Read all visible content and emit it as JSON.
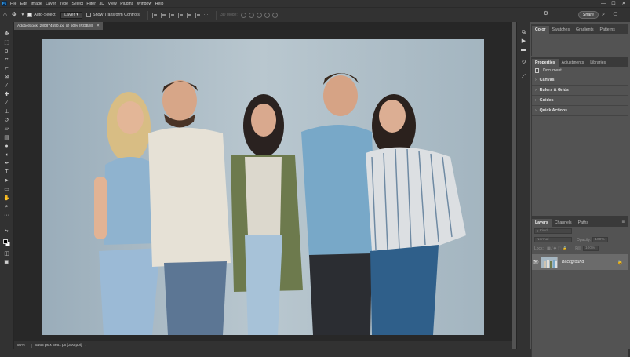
{
  "app": {
    "logo_text": "Ps",
    "menu": [
      "File",
      "Edit",
      "Image",
      "Layer",
      "Type",
      "Select",
      "Filter",
      "3D",
      "View",
      "Plugins",
      "Window",
      "Help"
    ],
    "window_controls": {
      "minimize": "—",
      "maximize": "☐",
      "close": "✕"
    }
  },
  "options_bar": {
    "auto_select_label": "Auto-Select:",
    "auto_select_checked": true,
    "auto_select_target": "Layer",
    "show_transform_label": "Show Transform Controls",
    "show_transform_checked": false,
    "mode_3d_label": "3D Mode:",
    "share_label": "Share"
  },
  "document": {
    "tab_title": "AdobeStock_280874550.jpg @ 50% (RGB/8)",
    "tab_close": "×",
    "zoom": "50%",
    "dimensions": "5463 px x 3661 px (300 ppi)",
    "status_arrow": "›"
  },
  "toolbar": {
    "tools": [
      "move-tool",
      "artboard-tool",
      "marquee-tool",
      "lasso-tool",
      "object-selection-tool",
      "crop-tool",
      "frame-tool",
      "eyedropper-tool",
      "healing-brush-tool",
      "brush-tool",
      "clone-stamp-tool",
      "history-brush-tool",
      "eraser-tool",
      "gradient-tool",
      "blur-tool",
      "dodge-tool",
      "pen-tool",
      "type-tool",
      "path-selection-tool",
      "rectangle-tool",
      "hand-tool",
      "zoom-tool",
      "more-tools"
    ],
    "foreground_color": "#000000",
    "background_color": "#ffffff"
  },
  "panels": {
    "color_tabs": [
      "Color",
      "Swatches",
      "Gradients",
      "Patterns"
    ],
    "properties_tabs": [
      "Properties",
      "Adjustments",
      "Libraries"
    ],
    "properties_header": "Document",
    "properties_sections": [
      "Canvas",
      "Rulers & Grids",
      "Guides",
      "Quick Actions"
    ],
    "layers_tabs": [
      "Layers",
      "Channels",
      "Paths"
    ],
    "layers_search_placeholder": "Kind",
    "blend_mode": "Normal",
    "opacity_label": "Opacity:",
    "opacity_value": "100%",
    "lock_label": "Lock:",
    "fill_label": "Fill:",
    "fill_value": "100%",
    "layer_name": "Background",
    "panel_menu_icon": "≡"
  },
  "colors": {
    "app_bg": "#535353",
    "bar_bg": "#323232",
    "canvas_bg": "#282828",
    "accent": "#31a8ff"
  }
}
